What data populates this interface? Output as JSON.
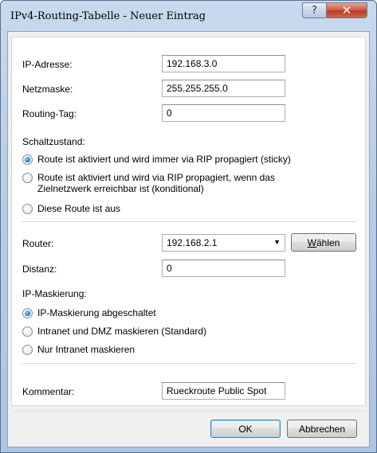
{
  "window": {
    "title": "IPv4-Routing-Tabelle - Neuer Eintrag",
    "help_glyph": "?",
    "close_glyph": "✕"
  },
  "fields": {
    "ip_label": "IP-Adresse:",
    "ip_value": "192.168.3.0",
    "mask_label": "Netzmaske:",
    "mask_value": "255.255.255.0",
    "tag_label": "Routing-Tag:",
    "tag_value": "0"
  },
  "schaltzustand": {
    "label": "Schaltzustand:",
    "options": [
      {
        "label": "Route ist aktiviert und wird immer via RIP propagiert (sticky)",
        "selected": true
      },
      {
        "label_line1": "Route ist aktiviert und wird via RIP propagiert, wenn das",
        "label_line2": "Zielnetzwerk erreichbar ist (konditional)",
        "selected": false
      },
      {
        "label": "Diese Route ist aus",
        "selected": false
      }
    ]
  },
  "router": {
    "label": "Router:",
    "value": "192.168.2.1",
    "choose_button": "Wählen",
    "arrow_icon": "chevron-down-icon"
  },
  "distanz": {
    "label": "Distanz:",
    "value": "0"
  },
  "masking": {
    "label": "IP-Maskierung:",
    "options": [
      {
        "label": "IP-Maskierung abgeschaltet",
        "selected": true
      },
      {
        "label": "Intranet und DMZ maskieren (Standard)",
        "selected": false
      },
      {
        "label": "Nur Intranet maskieren",
        "selected": false
      }
    ]
  },
  "comment": {
    "label": "Kommentar:",
    "value": "Rueckroute Public Spot"
  },
  "footer": {
    "ok": "OK",
    "cancel": "Abbrechen"
  }
}
